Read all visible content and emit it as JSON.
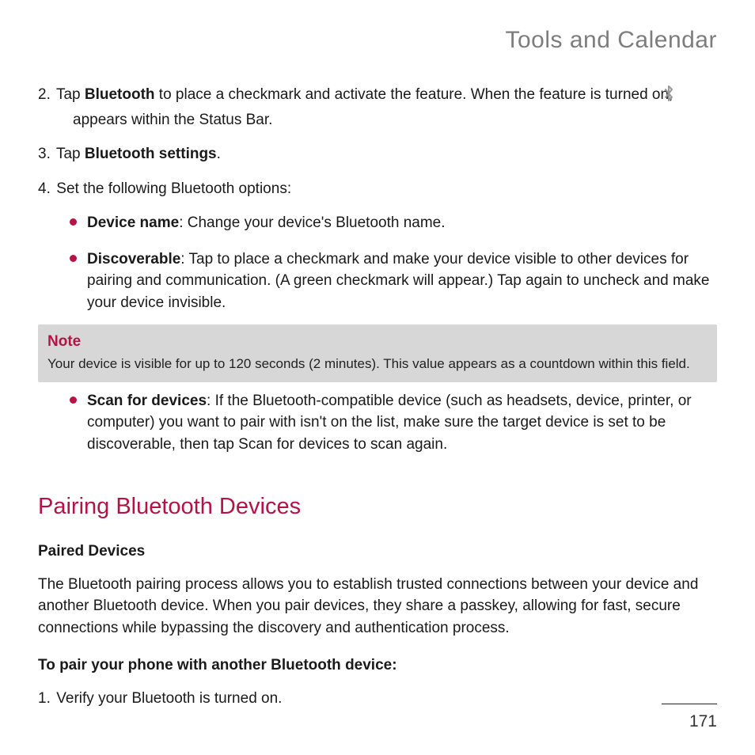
{
  "section_title": "Tools and Calendar",
  "steps": {
    "s2": {
      "num": "2.",
      "pre": "Tap ",
      "bold": "Bluetooth",
      "post": " to place a checkmark and activate the feature. When the feature is turned on, ",
      "cont": "appears within the Status Bar."
    },
    "s3": {
      "num": "3.",
      "pre": "Tap ",
      "bold": "Bluetooth settings",
      "post": "."
    },
    "s4": {
      "num": "4.",
      "text": "Set the following Bluetooth options:"
    }
  },
  "bullets": {
    "b1": {
      "bold": "Device name",
      "text": ": Change your device's Bluetooth name."
    },
    "b2": {
      "bold": "Discoverable",
      "text": ": Tap to place a checkmark and make your device visible to other devices for pairing and communication. (A green checkmark will appear.) Tap again to uncheck and make your device invisible."
    },
    "b3": {
      "bold": "Scan for devices",
      "text": ": If the Bluetooth-compatible device (such as headsets, device, printer, or computer) you want to pair with isn't on the list, make sure the target device is set to be discoverable, then tap Scan for devices to scan again."
    }
  },
  "note": {
    "title": "Note",
    "body": "Your device is visible for up to 120 seconds (2 minutes). This value appears as a countdown within this field."
  },
  "heading2": "Pairing Bluetooth Devices",
  "subheading": "Paired Devices",
  "paragraph": "The Bluetooth pairing process allows you to establish trusted connections between your device and another Bluetooth device. When you pair devices, they share a passkey, allowing for fast, secure connections while bypassing the discovery and authentication process.",
  "procedure_title": "To pair your phone with another Bluetooth device:",
  "step1": {
    "num": "1.",
    "text": "Verify your Bluetooth is turned on."
  },
  "page_number": "171"
}
